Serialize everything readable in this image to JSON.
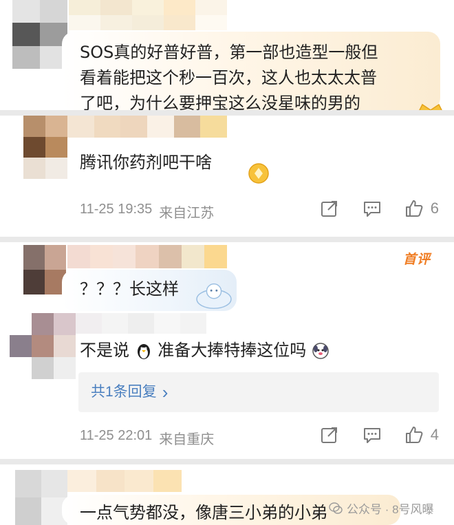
{
  "comments": [
    {
      "text_lines": [
        "SOS真的好普好普，第一部也造型一般但",
        "看着能把这个秒一百次，这人也太太太普",
        "了吧，为什么要押宝这么没星味的男的"
      ]
    },
    {
      "text": "腾讯你药剂吧干啥",
      "timestamp": "11-25 19:35",
      "location": "来自江苏",
      "likes": "6"
    },
    {
      "badge": "首评",
      "text": "？？？长这样"
    },
    {
      "text_before": "不是说",
      "text_after": "准备大捧特捧这位吗",
      "replies_label": "共1条回复",
      "replies_chevron": "›",
      "timestamp": "11-25 22:01",
      "location": "来自重庆",
      "likes": "4"
    },
    {
      "text": "一点气势都没，像唐三小弟的小弟"
    }
  ],
  "watermark": {
    "icon": "wechat-icon",
    "label": "公众号 · 8号风曝"
  },
  "icons": [
    "share-icon",
    "comment-icon",
    "thumbs-up-icon",
    "crown-emoji-icon",
    "penguin-emoji-icon",
    "dog-emoji-icon",
    "cloud-mascot-icon"
  ],
  "colors": {
    "text": "#222222",
    "meta": "#8f8f8f",
    "link": "#4a7fbf",
    "badge": "#f07d23",
    "strip": "#e9e9e9"
  }
}
